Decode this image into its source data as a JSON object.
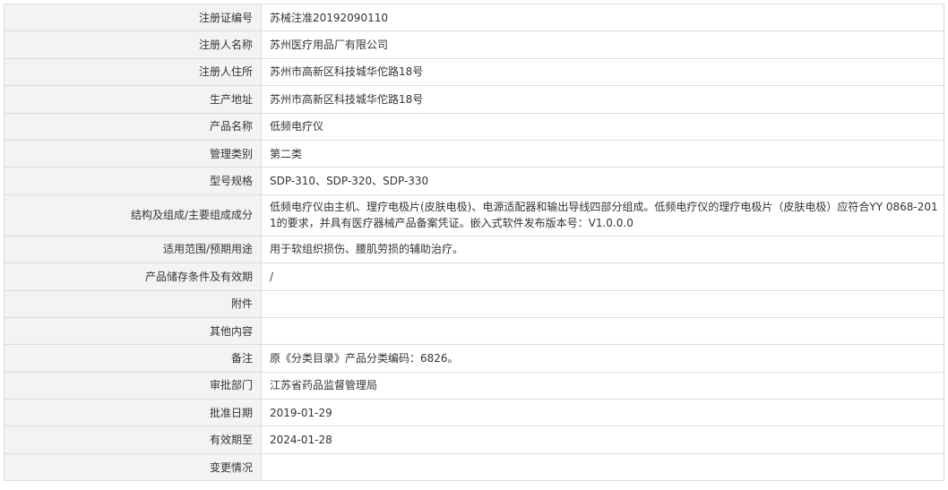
{
  "rows": [
    {
      "label": "注册证编号",
      "value": "苏械注准20192090110"
    },
    {
      "label": "注册人名称",
      "value": "苏州医疗用品厂有限公司"
    },
    {
      "label": "注册人住所",
      "value": "苏州市高新区科技城华佗路18号"
    },
    {
      "label": "生产地址",
      "value": "苏州市高新区科技城华佗路18号"
    },
    {
      "label": "产品名称",
      "value": "低频电疗仪"
    },
    {
      "label": "管理类别",
      "value": "第二类"
    },
    {
      "label": "型号规格",
      "value": "SDP-310、SDP-320、SDP-330"
    },
    {
      "label": "结构及组成/主要组成成分",
      "value": "低频电疗仪由主机、理疗电极片(皮肤电极)、电源适配器和输出导线四部分组成。低频电疗仪的理疗电极片（皮肤电极）应符合YY 0868-2011的要求，并具有医疗器械产品备案凭证。嵌入式软件发布版本号：V1.0.0.0"
    },
    {
      "label": "适用范围/预期用途",
      "value": "用于软组织损伤、腰肌劳损的辅助治疗。"
    },
    {
      "label": "产品储存条件及有效期",
      "value": "/"
    },
    {
      "label": "附件",
      "value": ""
    },
    {
      "label": "其他内容",
      "value": ""
    },
    {
      "label": "备注",
      "value": "原《分类目录》产品分类编码：6826。"
    },
    {
      "label": "审批部门",
      "value": "江苏省药品监督管理局"
    },
    {
      "label": "批准日期",
      "value": "2019-01-29"
    },
    {
      "label": "有效期至",
      "value": "2024-01-28"
    },
    {
      "label": "变更情况",
      "value": ""
    }
  ]
}
